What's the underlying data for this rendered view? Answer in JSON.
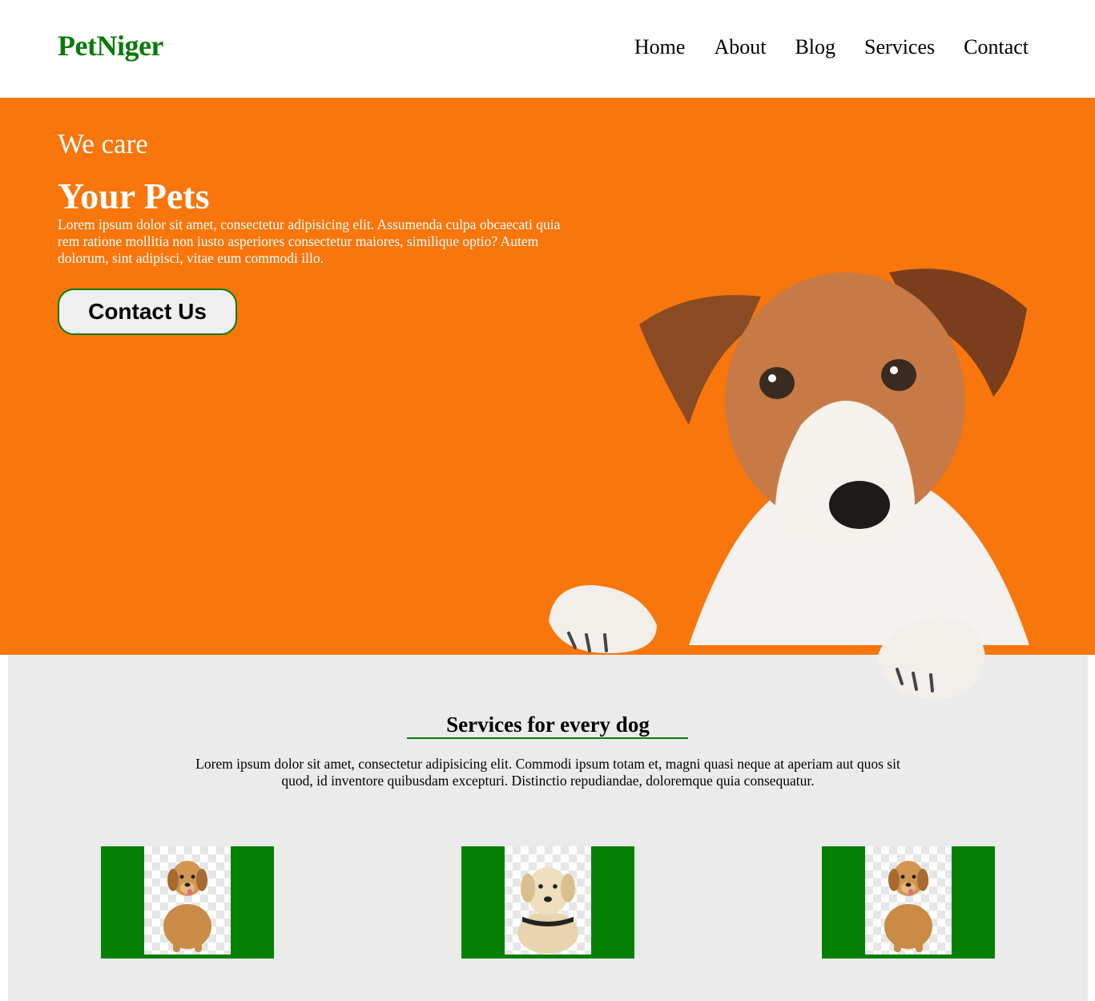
{
  "header": {
    "logo": "PetNiger",
    "nav": [
      "Home",
      "About",
      "Blog",
      "Services",
      "Contact"
    ]
  },
  "hero": {
    "subtitle": "We care",
    "title": "Your Pets",
    "text": "Lorem ipsum dolor sit amet, consectetur adipisicing elit. Assumenda culpa obcaecati quia rem ratione mollitia non iusto asperiores consectetur maiores, similique optio? Autem dolorum, sint adipisci, vitae eum commodi illo.",
    "button": "Contact Us",
    "background_color": "#f8760c"
  },
  "services": {
    "title": "Services for every dog",
    "text": "Lorem ipsum dolor sit amet, consectetur adipisicing elit. Commodi ipsum totam et, magni quasi neque at aperiam aut quos sit quod, id inventore quibusdam excepturi. Distinctio repudiandae, doloremque quia consequatur.",
    "accent_color": "#058005",
    "cards": [
      "golden-puppy",
      "labrador",
      "golden-puppy"
    ]
  }
}
